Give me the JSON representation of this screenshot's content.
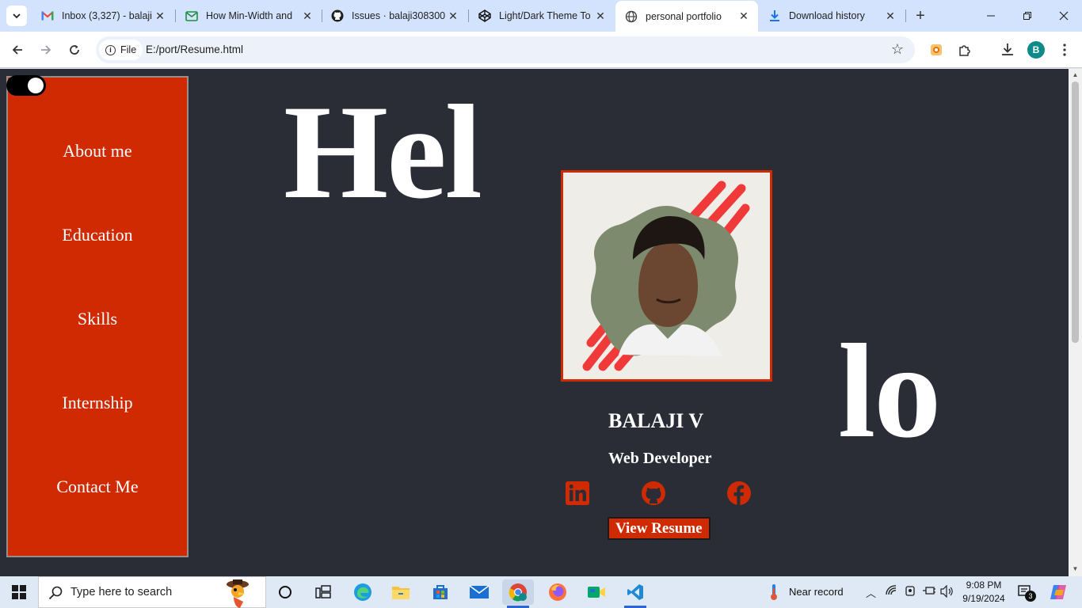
{
  "browser": {
    "tabs": [
      {
        "title": "Inbox (3,327) - balaji",
        "favicon": "gmail-icon"
      },
      {
        "title": "How Min-Width and",
        "favicon": "mail-check-icon"
      },
      {
        "title": "Issues · balaji308300/",
        "favicon": "github-icon"
      },
      {
        "title": "Light/Dark Theme To",
        "favicon": "codepen-icon"
      },
      {
        "title": "personal portfolio",
        "favicon": "globe-icon",
        "active": true
      },
      {
        "title": "Download history",
        "favicon": "download-icon"
      }
    ],
    "omnibox": {
      "scheme_chip": "File",
      "url": "E:/port/Resume.html"
    },
    "profile_initial": "B"
  },
  "page": {
    "sidebar": {
      "items": [
        "About me",
        "Education",
        "Skills",
        "Internship",
        "Contact Me"
      ]
    },
    "hero": {
      "left_text": "Hel",
      "right_text": "lo"
    },
    "profile": {
      "name": "BALAJI V",
      "role": "Web Developer",
      "resume_button": "View Resume"
    },
    "social": [
      "linkedin-icon",
      "github-icon",
      "facebook-icon"
    ],
    "colors": {
      "accent": "#cf2a02",
      "background": "#2a2d36",
      "text": "#ffffff"
    }
  },
  "taskbar": {
    "search_placeholder": "Type here to search",
    "weather": "Near record",
    "time": "9:08 PM",
    "date": "9/19/2024",
    "notification_count": "3"
  }
}
